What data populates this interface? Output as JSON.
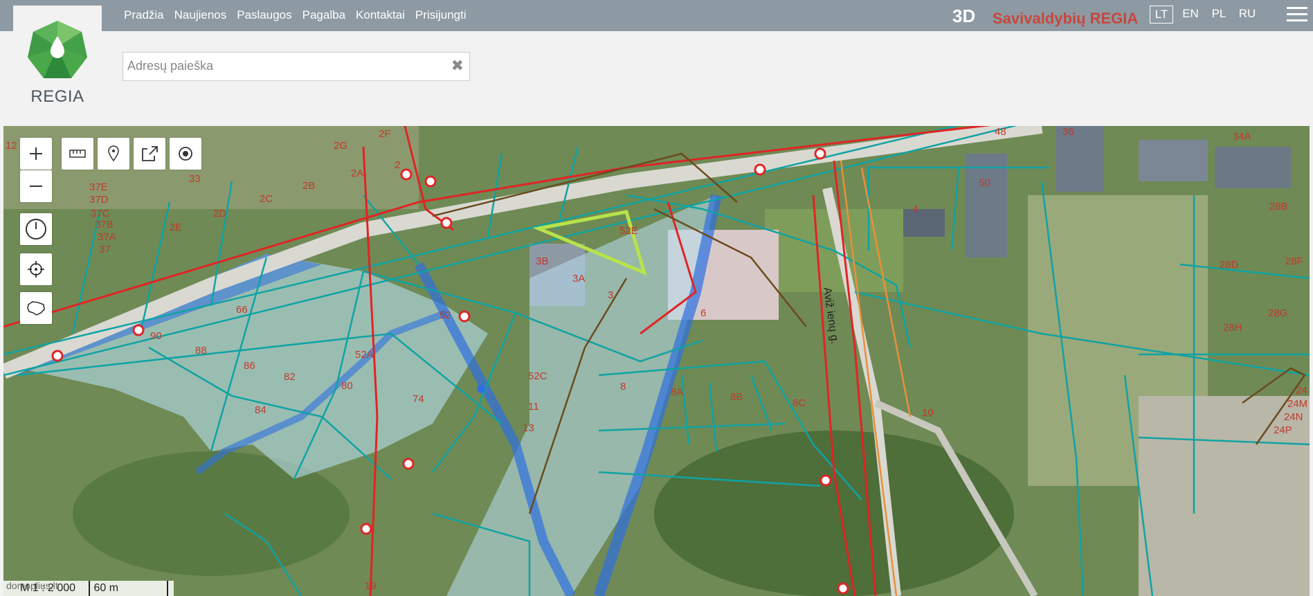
{
  "header": {
    "logo_text": "REGIA",
    "nav": [
      "Pradžia",
      "Naujienos",
      "Paslaugos",
      "Pagalba",
      "Kontaktai",
      "Prisijungti"
    ],
    "btn_3d": "3D",
    "brand": "Savivaldybių REGIA",
    "languages": [
      "LT",
      "EN",
      "PL",
      "RU"
    ],
    "active_language": "LT"
  },
  "search": {
    "placeholder": "Adresų paieška",
    "value": ""
  },
  "map": {
    "scale_ratio": "M 1 : 2 000",
    "scale_bar": "60 m",
    "watermark": "domoplius.lt",
    "street": "Aviž ienų g.",
    "parcel_labels": [
      "2F",
      "2G",
      "2",
      "2B",
      "2A",
      "33",
      "2E",
      "2D",
      "2C",
      "37E",
      "37D",
      "37C",
      "37B",
      "37A",
      "37",
      "3B",
      "3A",
      "3",
      "52",
      "52A",
      "52C",
      "66",
      "90",
      "88",
      "86",
      "82",
      "80",
      "84",
      "74",
      "11",
      "13",
      "6",
      "8",
      "8A",
      "8B",
      "8C",
      "10",
      "4",
      "50",
      "48",
      "36",
      "34A",
      "28B",
      "28D",
      "28F",
      "28G",
      "28H",
      "24",
      "24M",
      "24N",
      "24P",
      "12",
      "19",
      "52E",
      "3B"
    ],
    "colors": {
      "cadastre": "#0fa3a3",
      "utility_red": "#e02424",
      "selection": "#b7e34a",
      "protection_zone": "#2e6fe0"
    }
  },
  "tools": {
    "icons": [
      "zoom-in-icon",
      "zoom-out-icon",
      "measure-icon",
      "marker-icon",
      "share-icon",
      "target-icon",
      "history-icon",
      "locate-icon",
      "lithuania-icon"
    ]
  }
}
